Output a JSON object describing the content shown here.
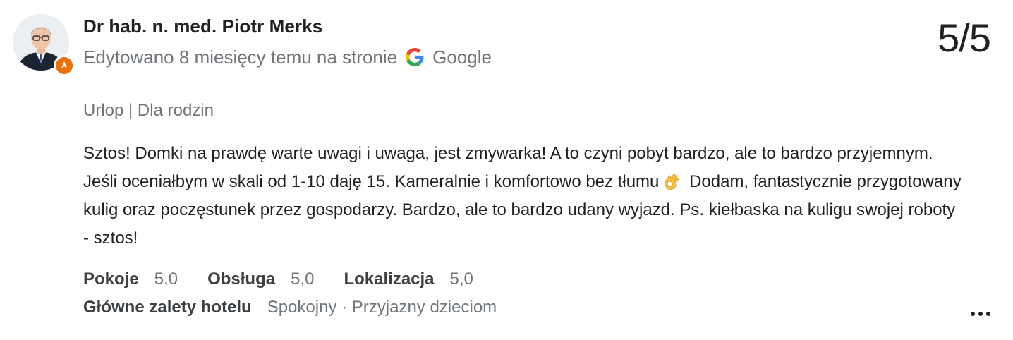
{
  "review": {
    "author": {
      "name": "Dr hab. n. med. Piotr Merks",
      "avatar_icon": "person-portrait-avatar",
      "badge_icon": "local-guide-badge-icon",
      "badge_color": "#e8710a"
    },
    "meta": {
      "edited_text": "Edytowano 8 miesięcy temu na stronie",
      "source_icon": "google-g-icon",
      "source_name": "Google"
    },
    "score": "5/5",
    "trip": "Urlop | Dla rodzin",
    "text": {
      "part1": "Sztos! Domki na prawdę warte uwagi i uwaga, jest zmywarka! A to czyni pobyt bardzo, ale to bardzo przyjemnym. Jeśli oceniałbym w skali od 1-10 daję 15. Kameralnie i komfortowo bez tłumu",
      "emoji_icon": "ok-hand-emoji-icon",
      "part2": "Dodam, fantastycznie przygotowany kulig oraz poczęstunek przez gospodarzy. Bardzo, ale to bardzo udany wyjazd. Ps. kiełbaska na kuligu swojej roboty - sztos!"
    },
    "ratings": [
      {
        "label": "Pokoje",
        "value": "5,0"
      },
      {
        "label": "Obsługa",
        "value": "5,0"
      },
      {
        "label": "Lokalizacja",
        "value": "5,0"
      }
    ],
    "highlights": {
      "label": "Główne zalety hotelu",
      "values": "Spokojny · Przyjazny dzieciom"
    },
    "more_icon": "more-horiz-icon"
  }
}
